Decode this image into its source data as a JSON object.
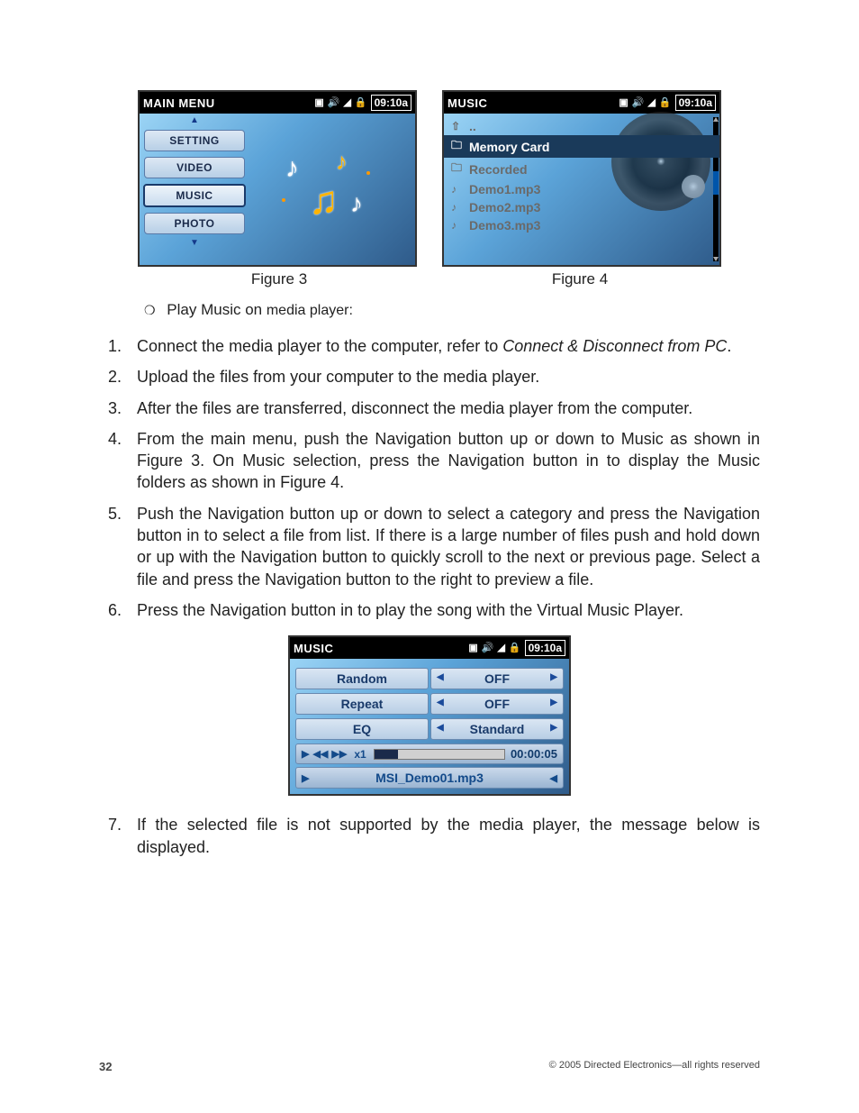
{
  "figure3": {
    "header": {
      "title": "MAIN MENU",
      "time": "09:10a"
    },
    "menu": [
      "SETTING",
      "VIDEO",
      "MUSIC",
      "PHOTO"
    ],
    "selected": "MUSIC",
    "caption": "Figure 3"
  },
  "figure4": {
    "header": {
      "title": "MUSIC",
      "time": "09:10a"
    },
    "items": [
      {
        "icon": "up",
        "label": ".."
      },
      {
        "icon": "folder",
        "label": "Memory Card",
        "selected": true
      },
      {
        "icon": "folder",
        "label": "Recorded"
      },
      {
        "icon": "music",
        "label": "Demo1.mp3"
      },
      {
        "icon": "music",
        "label": "Demo2.mp3"
      },
      {
        "icon": "music",
        "label": "Demo3.mp3"
      }
    ],
    "caption": "Figure 4"
  },
  "sub_bullet": {
    "lead": "Play Music on ",
    "trail": "media player:"
  },
  "steps": {
    "s1a": "Connect the media player to the computer, refer to ",
    "s1b": "Connect & Disconnect from PC",
    "s1c": ".",
    "s2": "Upload the files from your computer to the media player.",
    "s3": "After the files are transferred, disconnect the media player from the computer.",
    "s4": "From the main menu, push the Navigation button up or down to Music as shown in Figure 3. On Music selection, press the Navigation button in to display the Music folders as shown in Figure 4.",
    "s5": "Push the Navigation button up or down to select a category and press the Navigation button in to select a file from list. If there is a large number of files push and hold down or up with the Navigation button to quickly scroll to the next or previous page. Select a file and press the Navigation button to the right to preview a file.",
    "s6": "Press the Navigation button in to play the song with the Virtual Music Player.",
    "s7": "If the selected file is not supported by the media player, the message below is displayed."
  },
  "player": {
    "header": {
      "title": "MUSIC",
      "time": "09:10a"
    },
    "options": [
      {
        "label": "Random",
        "value": "OFF"
      },
      {
        "label": "Repeat",
        "value": "OFF"
      },
      {
        "label": "EQ",
        "value": "Standard"
      }
    ],
    "speed": "x1",
    "time": "00:00:05",
    "now_playing": "MSI_Demo01.mp3"
  },
  "footer": {
    "page": "32",
    "copyright": "© 2005 Directed Electronics—all rights reserved"
  }
}
